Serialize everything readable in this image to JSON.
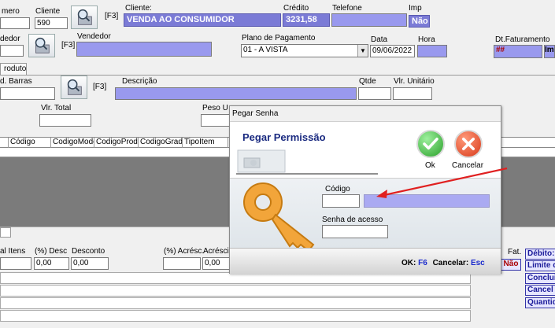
{
  "header_row1": {
    "numero_label": "mero",
    "cliente_label": "Cliente",
    "cliente_code": "590",
    "f3": "[F3]",
    "cliente_name_label": "Cliente:",
    "cliente_name": "VENDA AO CONSUMIDOR",
    "credito_label": "Crédito",
    "credito_value": "3231,58",
    "telefone_label": "Telefone",
    "imp_label": "Imp",
    "imp_value": "Não"
  },
  "header_row2": {
    "vendedor_short_label": "dedor",
    "f3": "[F3]",
    "vendedor_label": "Vendedor",
    "plano_label": "Plano de Pagamento",
    "plano_value": "01 - A VISTA",
    "data_label": "Data",
    "data_value": "09/06/2022",
    "hora_label": "Hora",
    "dt_faturamento_label": "Dt.Faturamento",
    "dt_faturamento_value": "##",
    "im_value": "Im"
  },
  "tab": {
    "label": "roduto"
  },
  "product_row": {
    "cod_barras_label": "d. Barras",
    "f3": "[F3]",
    "descricao_label": "Descrição",
    "qtde_label": "Qtde",
    "vlr_unitario_label": "Vlr. Unitário",
    "vlr_total_label": "Vlr. Total",
    "peso_label": "Peso U"
  },
  "grid": {
    "columns": [
      "",
      "Código",
      "CodigoModel",
      "CodigoProdu",
      "CodigoGrade",
      "TipoItem"
    ]
  },
  "totals": {
    "total_itens_label": "al Itens",
    "desc_pct_label": "(%) Desc",
    "desc_pct_value": "0,00",
    "desconto_label": "Desconto",
    "desconto_value": "0,00",
    "acresc_pct_label": "(%) Acrésc.",
    "acrescimo_label": "Acrésci",
    "acrescimo_value": "0,00",
    "fat_label": "Fat.",
    "fat_value": "Não"
  },
  "side_buttons": [
    "Débito:",
    "Limite d",
    "Conclui",
    "Cancel",
    "Quantid"
  ],
  "dialog": {
    "title": "Pegar Senha",
    "heading": "Pegar Permissão",
    "ok_label": "Ok",
    "cancel_label": "Cancelar",
    "codigo_label": "Código",
    "codigo_value": "",
    "senha_label": "Senha de acesso",
    "shortcut_ok_label": "OK:",
    "shortcut_ok_key": "F6",
    "shortcut_cancel_label": "Cancelar:",
    "shortcut_cancel_key": "Esc"
  },
  "colors": {
    "lavender": "#9999ee",
    "dark_blue_field": "#7b7bd6",
    "grid_gray": "#7b7b7b",
    "arrow_red": "#e02020"
  }
}
